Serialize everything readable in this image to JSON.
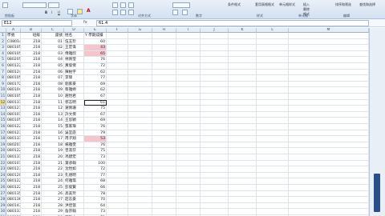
{
  "ribbon": {
    "groups": [
      "剪贴板",
      "字体",
      "对齐方式",
      "数字",
      "样式",
      "单元格",
      "编辑"
    ],
    "buttons": {
      "conditional_format": "条件格式",
      "table_format": "套用表格格式",
      "cell_style": "单元格样式",
      "insert": "插入",
      "delete": "删除",
      "format": "格式",
      "sort_filter": "排序和筛选",
      "find_select": "查找和选择"
    }
  },
  "formula_bar": {
    "name_box": "E12",
    "fx": "fx",
    "content": "61.4"
  },
  "columns": [
    "A",
    "B",
    "C",
    "D",
    "E",
    "F",
    "G",
    "H",
    "I",
    "J",
    "K",
    "L",
    "M"
  ],
  "header_row": [
    "學號",
    "班級",
    "座號",
    "姓名",
    "Y 學期成績"
  ],
  "rows": [
    [
      "C0801401",
      "218",
      "01",
      "伍玉珍",
      "60"
    ],
    [
      "0801054",
      "218",
      "02",
      "王宏偉",
      "43"
    ],
    [
      "0801052",
      "218",
      "03",
      "傅雅欣",
      "65"
    ],
    [
      "0802054",
      "218",
      "04",
      "林佩瑩",
      "76"
    ],
    [
      "0801223",
      "218",
      "05",
      "黃俊傑",
      "72"
    ],
    [
      "0801247",
      "218",
      "06",
      "陳柏宇",
      "62"
    ],
    [
      "0801056",
      "218",
      "07",
      "李瑋",
      "77"
    ],
    [
      "0801728",
      "218",
      "08",
      "劉家豪",
      "69"
    ],
    [
      "0801040",
      "218",
      "09",
      "蔡雅婷",
      "62"
    ],
    [
      "0801057",
      "218",
      "10",
      "趙怡君",
      "67"
    ],
    [
      "0801313",
      "218",
      "11",
      "郭志明",
      "61"
    ],
    [
      "0801219",
      "218",
      "12",
      "謝佩珊",
      "75"
    ],
    [
      "0801018",
      "218",
      "13",
      "許文傑",
      "67"
    ],
    [
      "0801050",
      "218",
      "14",
      "王思穎",
      "69"
    ],
    [
      "0801228",
      "218",
      "15",
      "張家瑋",
      "76"
    ],
    [
      "0801235",
      "218",
      "16",
      "吳宜庭",
      "79"
    ],
    [
      "0801317",
      "218",
      "17",
      "周子翔",
      "53"
    ],
    [
      "0802017",
      "218",
      "18",
      "楊雅雯",
      "76"
    ],
    [
      "0801227",
      "218",
      "19",
      "曾淑芬",
      "75"
    ],
    [
      "0801311",
      "218",
      "20",
      "馮建宏",
      "73"
    ],
    [
      "0801017",
      "218",
      "21",
      "葉承翰",
      "100"
    ],
    [
      "0801232",
      "218",
      "22",
      "沈怡如",
      "72"
    ],
    [
      "0801208",
      "218",
      "23",
      "孔德明",
      "77"
    ],
    [
      "0801224",
      "218",
      "24",
      "何雅琪",
      "68"
    ],
    [
      "0801226",
      "218",
      "25",
      "彭俊賢",
      "66"
    ],
    [
      "0801355",
      "218",
      "26",
      "高美玲",
      "78"
    ],
    [
      "0801360",
      "218",
      "27",
      "莊志豪",
      "70"
    ],
    [
      "0801430",
      "218",
      "28",
      "洪佳蓉",
      "64"
    ],
    [
      "0801331",
      "218",
      "29",
      "詹宗翰",
      "73"
    ],
    [
      "0801332",
      "218",
      "30",
      "鄭雅文",
      "71"
    ]
  ],
  "colors": {
    "highlight": "#f6c4cc",
    "ribbon": "#d4e1f1",
    "scroll_thumb": "#2a4f86"
  }
}
